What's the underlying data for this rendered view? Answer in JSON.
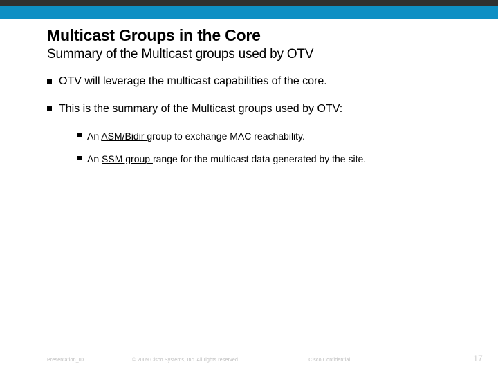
{
  "slide": {
    "title": "Multicast Groups in the Core",
    "subtitle": "Summary of the Multicast groups used by OTV",
    "bullets": [
      {
        "text": "OTV will leverage the multicast capabilities of the core."
      },
      {
        "text": "This is the summary of the Multicast groups used by OTV:"
      }
    ],
    "sub_bullets": [
      {
        "pre": "An ",
        "under": "ASM/Bidir ",
        "post": "group to exchange MAC reachability."
      },
      {
        "pre": "An ",
        "under": "SSM group ",
        "post": "range for the multicast data generated by the site."
      }
    ]
  },
  "footer": {
    "left": "Presentation_ID",
    "copyright": "© 2009 Cisco Systems, Inc. All rights reserved.",
    "confidential": "Cisco Confidential",
    "page": "17"
  }
}
